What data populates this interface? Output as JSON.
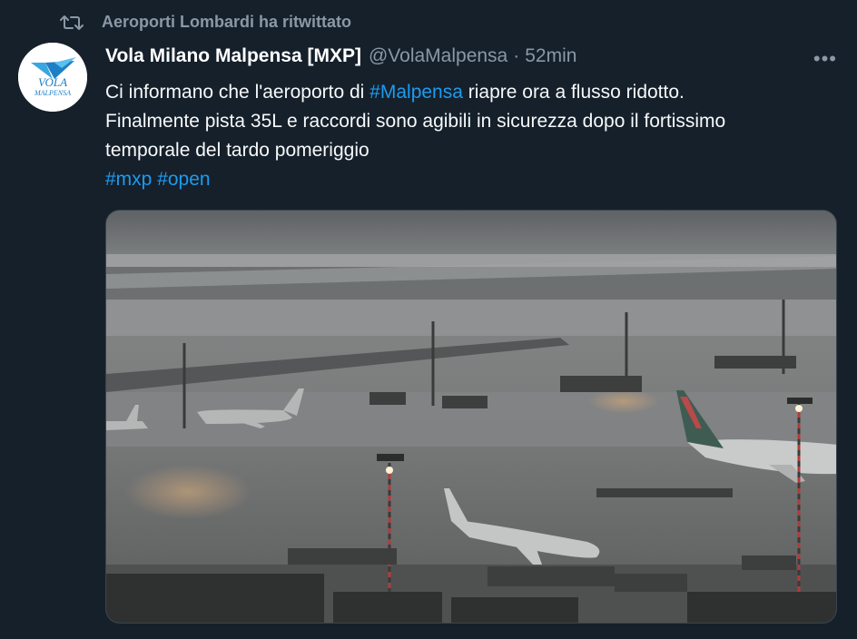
{
  "retweet": {
    "label": "Aeroporti Lombardi ha ritwittato",
    "icon": "retweet-icon"
  },
  "author": {
    "display_name": "Vola Milano Malpensa [MXP]",
    "handle": "@VolaMalpensa",
    "separator": "·",
    "time": "52min",
    "avatar_text": "Vola Malpensa"
  },
  "more": {
    "label": "•••",
    "icon": "more-icon"
  },
  "tweet": {
    "line1_prefix": "Ci informano che l'aeroporto di ",
    "line1_hashtag": "#Malpensa",
    "line1_suffix": " riapre ora a flusso ridotto.",
    "line2": "Finalmente pista 35L e raccordi sono agibili in sicurezza dopo il fortissimo",
    "line3": "temporale del tardo pomeriggio",
    "hashtag_mxp": "#mxp",
    "hashtag_open": "#open"
  },
  "media": {
    "alt": "Rain-soaked airport apron with parked aircraft"
  },
  "colors": {
    "background": "#15202b",
    "accent": "#1d9bf0",
    "muted": "#8b98a5",
    "text": "#f7f9f9"
  }
}
